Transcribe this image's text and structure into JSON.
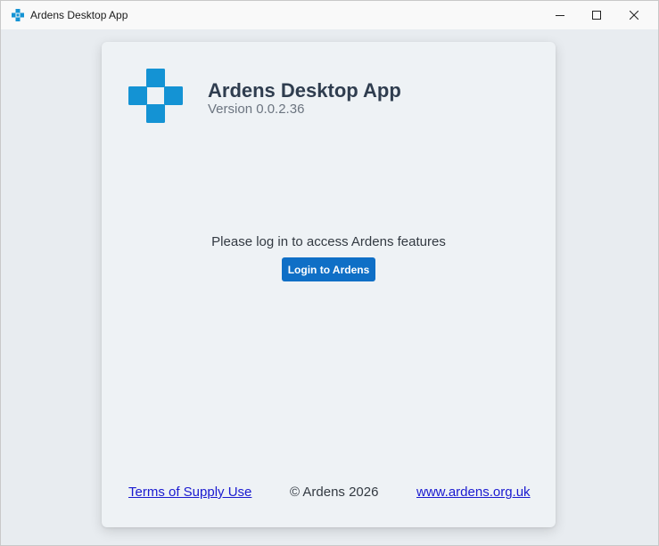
{
  "window": {
    "title": "Ardens Desktop App",
    "controls": {
      "minimize_icon": "minimize-icon",
      "maximize_icon": "maximize-icon",
      "close_icon": "close-icon"
    }
  },
  "header": {
    "logo_icon": "ardens-cross-logo-icon",
    "title": "Ardens Desktop App",
    "version": "Version 0.0.2.36"
  },
  "main": {
    "prompt": "Please log in to access Ardens features",
    "login_button_label": "Login to Ardens"
  },
  "footer": {
    "terms_link": "Terms of Supply Use",
    "copyright": "© Ardens 2026",
    "website_link": "www.ardens.org.uk"
  },
  "colors": {
    "brand_blue": "#1493d4",
    "button_blue": "#0f6fc6",
    "link": "#1a1ad0",
    "title_text": "#2f3d4f"
  }
}
